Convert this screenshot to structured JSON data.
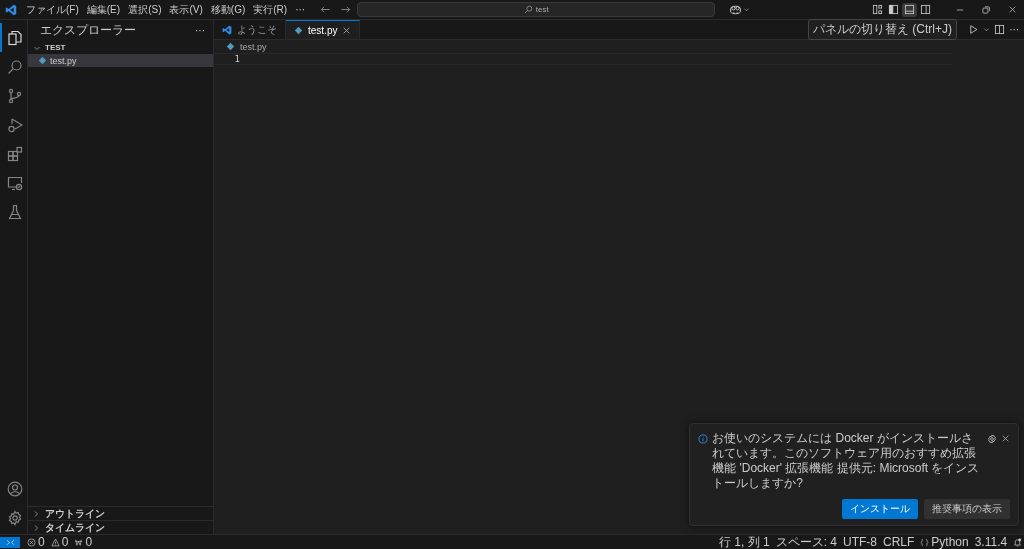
{
  "title_bar": {
    "menus": [
      "ファイル(F)",
      "編集(E)",
      "選択(S)",
      "表示(V)",
      "移動(G)",
      "実行(R)",
      "···"
    ],
    "search": {
      "value": "test"
    },
    "tooltip": "パネルの切り替え (Ctrl+J)"
  },
  "activity_bar": {
    "items": [
      {
        "kind": "explorer",
        "selected": true
      },
      {
        "kind": "search",
        "selected": false
      },
      {
        "kind": "source-control",
        "selected": false
      },
      {
        "kind": "run-debug",
        "selected": false
      },
      {
        "kind": "extensions",
        "selected": false
      },
      {
        "kind": "remote",
        "selected": false
      },
      {
        "kind": "testing",
        "selected": false
      }
    ],
    "bottom": [
      {
        "kind": "account"
      },
      {
        "kind": "settings"
      }
    ]
  },
  "sidebar": {
    "title": "エクスプローラー",
    "more": "···",
    "folder": {
      "name": "TEST",
      "expanded": true,
      "children": [
        {
          "name": "test.py",
          "selected": true
        }
      ]
    },
    "sections": [
      {
        "title": "アウトライン",
        "expanded": false
      },
      {
        "title": "タイムライン",
        "expanded": false
      }
    ]
  },
  "tabs": [
    {
      "label": "ようこそ",
      "kind": "welcome",
      "selected": false
    },
    {
      "label": "test.py",
      "kind": "python",
      "selected": true
    }
  ],
  "breadcrumb": [
    "test.py"
  ],
  "editor": {
    "line_numbers": [
      "1"
    ],
    "more": "···"
  },
  "notification": {
    "message": "お使いのシステムには Docker がインストールされています。このソフトウェア用のおすすめ拡張機能 'Docker' 拡張機能 提供元: Microsoft をインストールしますか?",
    "buttons": [
      {
        "label": "インストール",
        "kind": "primary"
      },
      {
        "label": "推奨事項の表示",
        "kind": "secondary"
      }
    ]
  },
  "status_bar": {
    "left": [
      {
        "kind": "errors",
        "text": "0"
      },
      {
        "kind": "warnings",
        "text": "0"
      },
      {
        "kind": "ports",
        "text": "0"
      }
    ],
    "right": [
      {
        "kind": "text",
        "text": "行 1, 列 1"
      },
      {
        "kind": "text",
        "text": "スペース: 4"
      },
      {
        "kind": "text",
        "text": "UTF-8"
      },
      {
        "kind": "text",
        "text": "CRLF"
      },
      {
        "kind": "language",
        "text": "Python"
      },
      {
        "kind": "text",
        "text": "3.11.4"
      }
    ]
  }
}
